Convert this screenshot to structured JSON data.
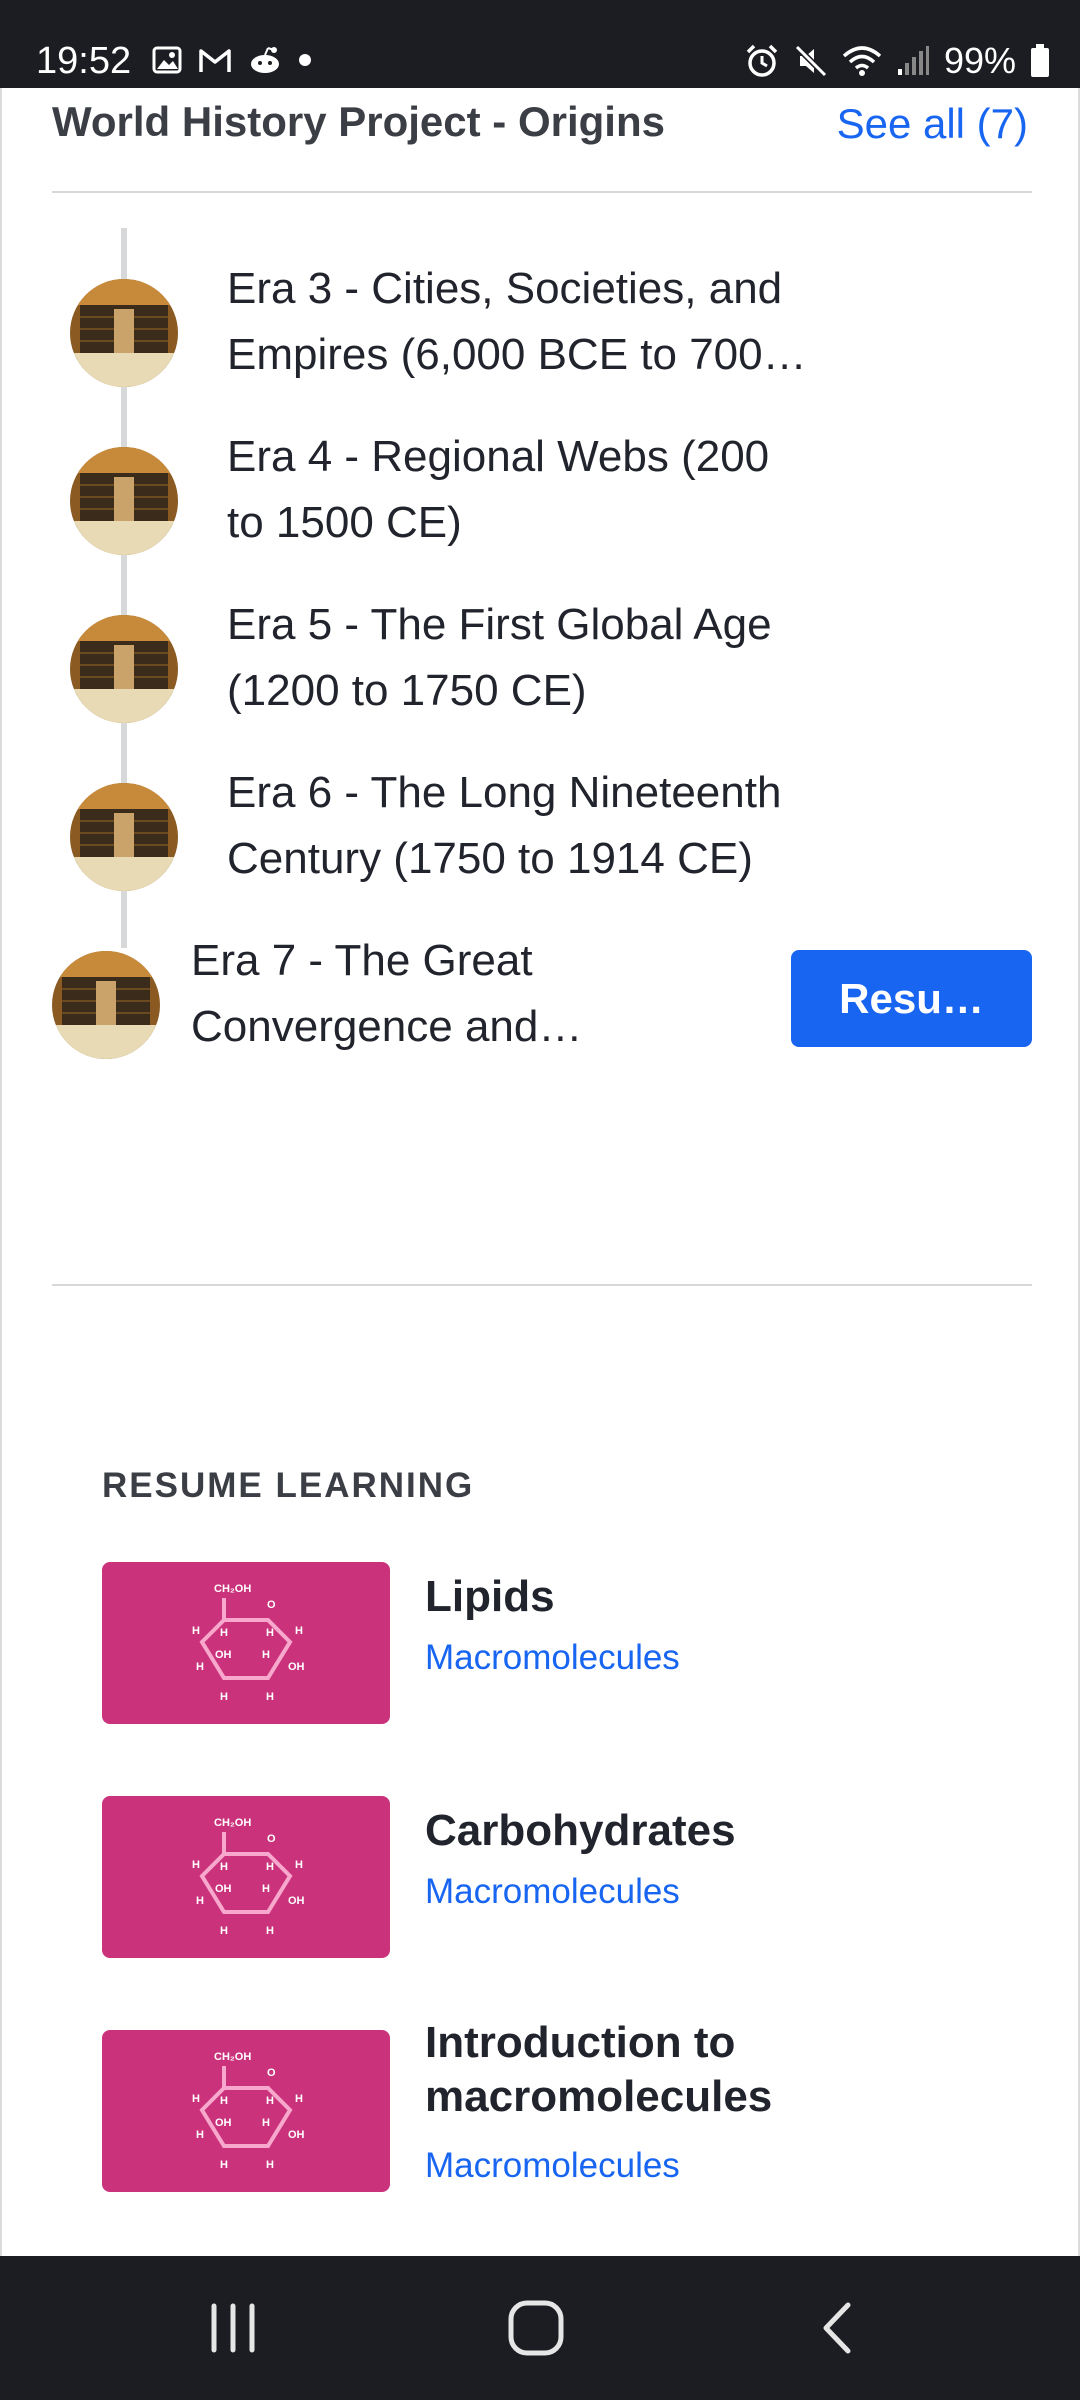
{
  "status_bar": {
    "time": "19:52",
    "battery_text": "99%",
    "left_icons": [
      "image-icon",
      "gmail-icon",
      "reddit-icon",
      "dot-icon"
    ],
    "right_icons": [
      "alarm-icon",
      "mute-icon",
      "wifi-icon",
      "signal-icon",
      "battery-icon"
    ]
  },
  "course": {
    "title": "World History Project - Origins",
    "see_all": "See all (7)"
  },
  "units": [
    {
      "line1": "Era 3 - Cities, Societies, and",
      "line2": "Empires (6,000 BCE to 700…"
    },
    {
      "line1": "Era 4 - Regional Webs (200",
      "line2": "to 1500 CE)"
    },
    {
      "line1": "Era 5 - The First Global Age",
      "line2": "(1200 to 1750 CE)"
    },
    {
      "line1": "Era 6 - The Long Nineteenth",
      "line2": "Century (1750 to 1914 CE)"
    },
    {
      "line1": "Era 7 - The Great",
      "line2": "Convergence and…"
    }
  ],
  "resume_button": "Resu…",
  "resume_learning": {
    "heading": "RESUME LEARNING",
    "items": [
      {
        "title": "Lipids",
        "subtitle": "Macromolecules"
      },
      {
        "title": "Carbohydrates",
        "subtitle": "Macromolecules"
      },
      {
        "title_line1": "Introduction to",
        "title_line2": "macromolecules",
        "subtitle": "Macromolecules"
      }
    ]
  },
  "molecule_labels": {
    "ch2oh": "CH₂OH",
    "o": "O",
    "h": "H",
    "oh": "OH"
  },
  "colors": {
    "accent": "#1865f2",
    "thumbnail_bg": "#ca337c",
    "bar_bg": "#1c1d22"
  },
  "nav_bar": [
    "recent-apps-icon",
    "home-icon",
    "back-icon"
  ]
}
